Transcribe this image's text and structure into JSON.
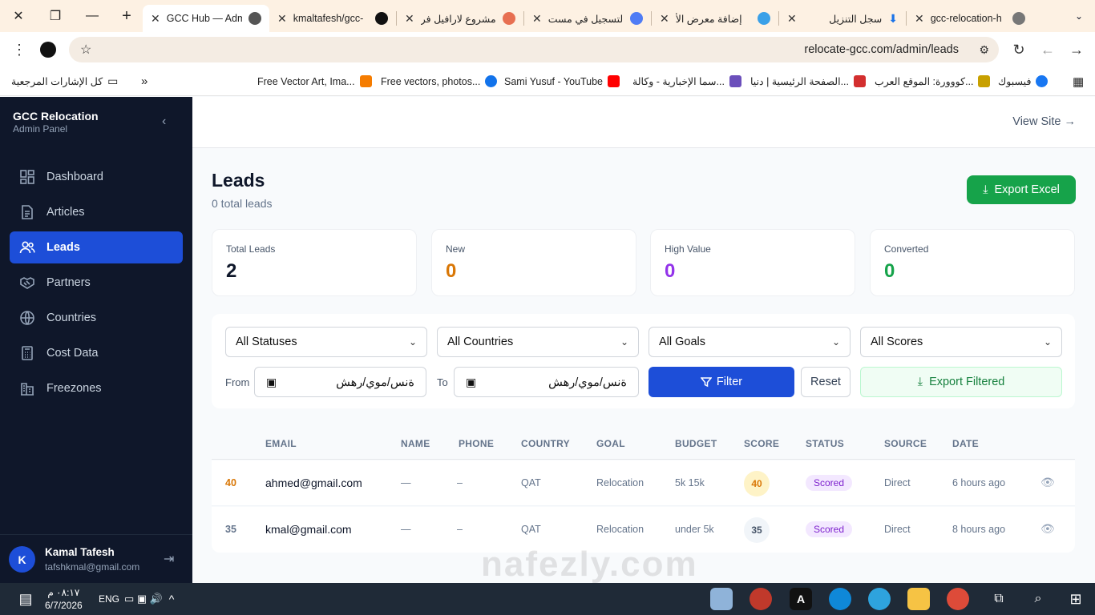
{
  "browser": {
    "tabs": [
      {
        "title": "GCC Hub — Adm",
        "active": true
      },
      {
        "title": "kmaltafesh/gcc-",
        "active": false
      },
      {
        "title": "مشروع لارافيل فر",
        "active": false
      },
      {
        "title": "التسجيل في مست",
        "active": false
      },
      {
        "title": "إضافة معرض الأ",
        "active": false
      },
      {
        "title": "سجل التنزيل",
        "active": false
      },
      {
        "title": "gcc-relocation-h",
        "active": false
      }
    ],
    "url": "relocate-gcc.com/admin/leads",
    "bookmarks": [
      {
        "label": "كل الإشارات المرجعية"
      },
      {
        "label": "Free Vector Art, Ima..."
      },
      {
        "label": "Free vectors, photos..."
      },
      {
        "label": "Sami Yusuf - YouTube"
      },
      {
        "label": "سما الإخبارية - وكالة..."
      },
      {
        "label": "الصفحة الرئيسية | دنيا..."
      },
      {
        "label": "كووورة: الموقع العرب..."
      },
      {
        "label": "فيسبوك"
      }
    ]
  },
  "sidebar": {
    "brand_title": "GCC Relocation",
    "brand_subtitle": "Admin Panel",
    "items": [
      {
        "label": "Dashboard",
        "icon": "dashboard-icon"
      },
      {
        "label": "Articles",
        "icon": "document-icon"
      },
      {
        "label": "Leads",
        "icon": "users-icon",
        "active": true
      },
      {
        "label": "Partners",
        "icon": "handshake-icon"
      },
      {
        "label": "Countries",
        "icon": "globe-icon"
      },
      {
        "label": "Cost Data",
        "icon": "calculator-icon"
      },
      {
        "label": "Freezones",
        "icon": "building-icon"
      }
    ],
    "user": {
      "initial": "K",
      "name": "Kamal Tafesh",
      "email": "tafshkmal@gmail.com"
    }
  },
  "header": {
    "view_site": "View Site →"
  },
  "page": {
    "title": "Leads",
    "subtitle": "0 total leads",
    "export_label": "Export Excel"
  },
  "stats": [
    {
      "label": "Total Leads",
      "value": "2",
      "color": "#0f172a"
    },
    {
      "label": "New",
      "value": "0",
      "color": "#d97706"
    },
    {
      "label": "High Value",
      "value": "0",
      "color": "#9333ea"
    },
    {
      "label": "Converted",
      "value": "0",
      "color": "#16a34a"
    }
  ],
  "filters": {
    "status": "All Statuses",
    "country": "All Countries",
    "goal": "All Goals",
    "score": "All Scores",
    "from_label": "From",
    "to_label": "To",
    "date_placeholder": "ةنس/موي/رهش",
    "filter_label": "Filter",
    "reset_label": "Reset",
    "export_filtered_label": "Export Filtered"
  },
  "table": {
    "headers": [
      "EMAIL",
      "NAME",
      "PHONE",
      "COUNTRY",
      "GOAL",
      "BUDGET",
      "SCORE",
      "STATUS",
      "SOURCE",
      "DATE"
    ],
    "rows": [
      {
        "score_num": "40",
        "email": "ahmed@gmail.com",
        "name": "—",
        "phone": "–",
        "country": "QAT",
        "goal": "Relocation",
        "budget": "5k 15k",
        "score": "40",
        "status": "Scored",
        "source": "Direct",
        "date": "6 hours ago",
        "score_color": "#d97706",
        "score_bg": "#fef3c7"
      },
      {
        "score_num": "35",
        "email": "kmal@gmail.com",
        "name": "—",
        "phone": "–",
        "country": "QAT",
        "goal": "Relocation",
        "budget": "under 5k",
        "score": "35",
        "status": "Scored",
        "source": "Direct",
        "date": "8 hours ago",
        "score_color": "#475569",
        "score_bg": "#f1f5f9"
      }
    ]
  },
  "watermark": {
    "text": "nafezly.com"
  },
  "taskbar": {
    "time": "٠٨:١٧ م",
    "date": "6/7/2026",
    "lang": "ENG"
  }
}
